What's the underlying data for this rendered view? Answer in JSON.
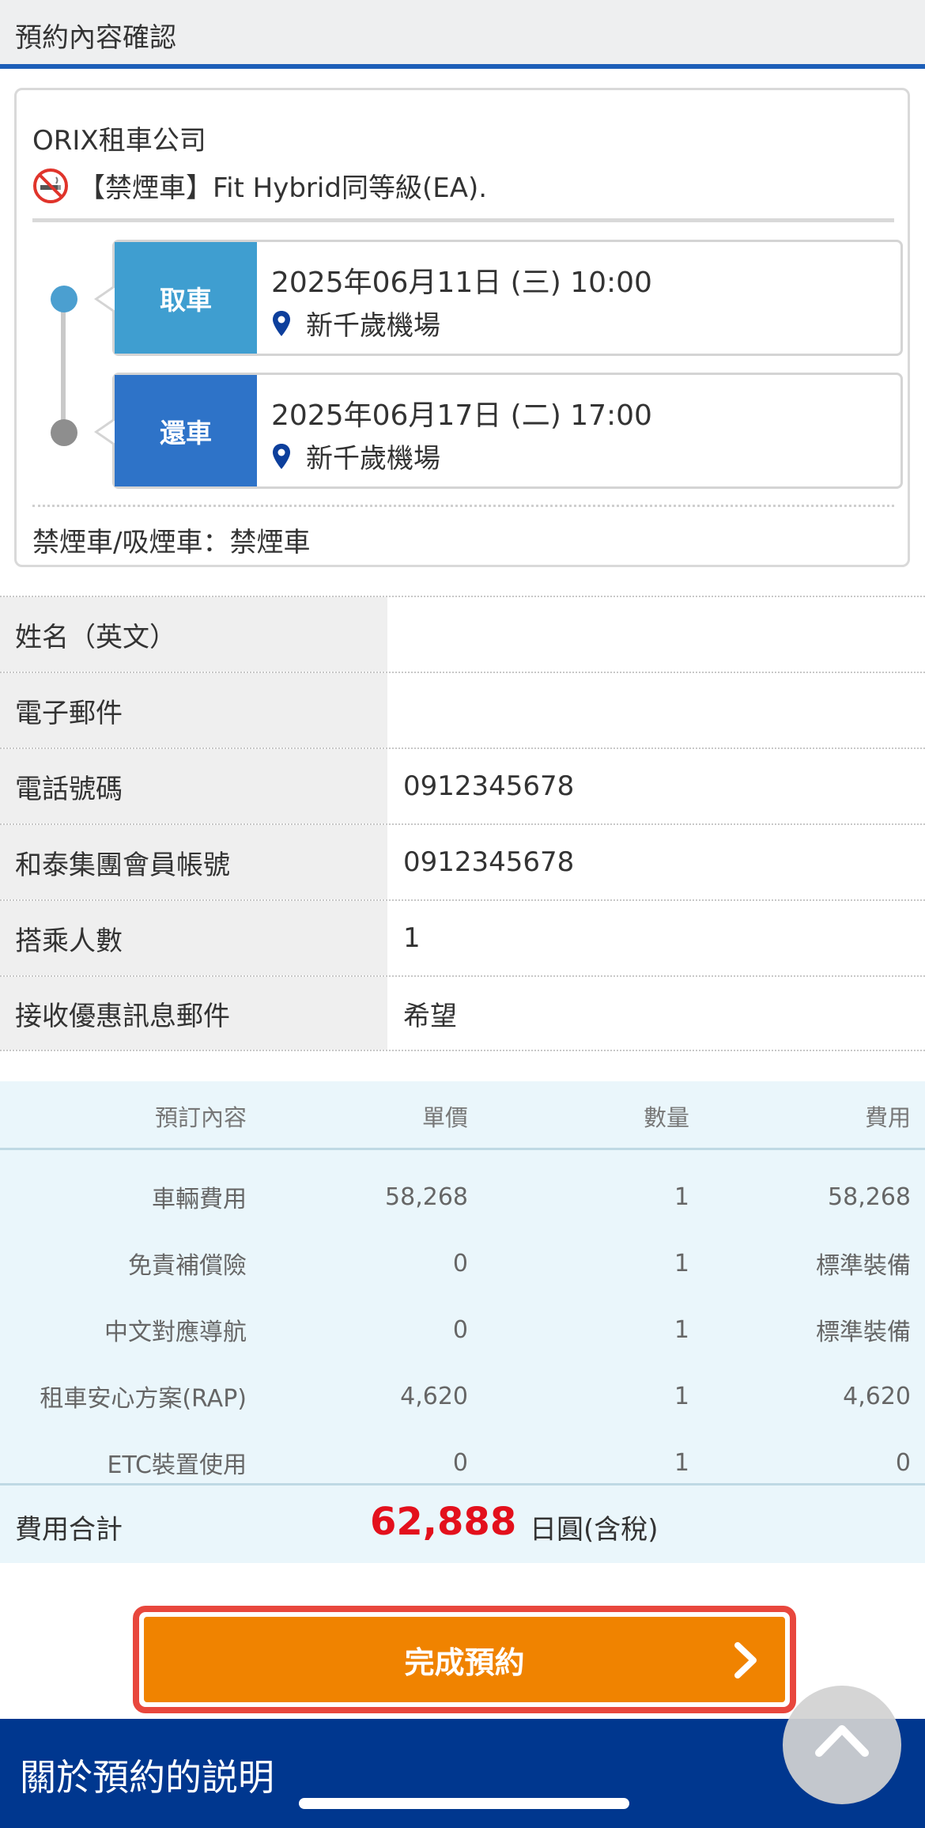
{
  "header": {
    "title": "預約內容確認"
  },
  "reservation": {
    "company": "ORIX租車公司",
    "car": "【禁煙車】Fit Hybrid同等級(EA).",
    "pickup": {
      "label": "取車",
      "datetime": "2025年06月11日 (三) 10:00",
      "location": "新千歲機場"
    },
    "return": {
      "label": "還車",
      "datetime": "2025年06月17日 (二) 17:00",
      "location": "新千歲機場"
    },
    "smoking": "禁煙車/吸煙車：禁煙車"
  },
  "customer": [
    {
      "label": "姓名（英文）",
      "value": ""
    },
    {
      "label": "電子郵件",
      "value": ""
    },
    {
      "label": "電話號碼",
      "value": "0912345678"
    },
    {
      "label": "和泰集團會員帳號",
      "value": "0912345678"
    },
    {
      "label": "搭乘人數",
      "value": "1"
    },
    {
      "label": "接收優惠訊息郵件",
      "value": "希望"
    }
  ],
  "fees": {
    "headers": [
      "預訂內容",
      "單價",
      "數量",
      "費用"
    ],
    "rows": [
      [
        "車輛費用",
        "58,268",
        "1",
        "58,268"
      ],
      [
        "免責補償險",
        "0",
        "1",
        "標準裝備"
      ],
      [
        "中文對應導航",
        "0",
        "1",
        "標準裝備"
      ],
      [
        "租車安心方案(RAP)",
        "4,620",
        "1",
        "4,620"
      ],
      [
        "ETC裝置使用",
        "0",
        "1",
        "0"
      ]
    ],
    "total_label": "費用合計",
    "total_amount": "62,888",
    "total_unit": "日圓(含稅)"
  },
  "actions": {
    "complete_label": "完成預約"
  },
  "footer": {
    "title": "關於預約的説明"
  },
  "colors": {
    "accent_blue": "#1d5eb8",
    "pickup": "#3f9ed0",
    "return": "#2e73c8",
    "button": "#f08300",
    "total": "#e3101c",
    "footer": "#00378f"
  }
}
